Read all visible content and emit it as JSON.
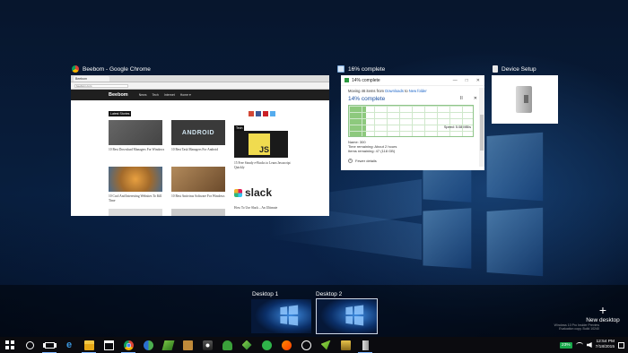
{
  "windows": [
    {
      "title": "Beebom - Google Chrome",
      "icon": "chrome-icon"
    },
    {
      "title": "16% complete",
      "icon": "file-copy-icon"
    },
    {
      "title": "Device Setup",
      "icon": "device-setup-icon"
    }
  ],
  "chrome_page": {
    "tab_label": "Beebom",
    "url": "beebom.com",
    "logo": "Beebom",
    "nav": [
      "News",
      "Tech",
      "Internet",
      "Home ▾"
    ],
    "latest_tag": "Latest Stories",
    "tech_tag": "Tech",
    "android_tile": "ANDROID",
    "js_tile": "JS",
    "slack_tile": "slack",
    "articles": [
      "10 Best Download Managers For Windows",
      "10 Best Task Managers For Android",
      "10 Cool And Interesting Websites To Kill Time",
      "10 Best Antivirus Software For Windows",
      "15 Free Steady e-Books to Learn Javascript Quickly",
      "How To Use Slack – An Ultimate"
    ]
  },
  "transfer": {
    "title": "14% complete",
    "moving_prefix": "Moving 46 items from ",
    "source": "Downloads",
    "to_word": " to ",
    "destination": "New folder",
    "progress_label": "14% complete",
    "progress_percent": 14,
    "pause_glyph": "II",
    "cancel_glyph": "✕",
    "speed": "Speed: 5.08 MB/s",
    "name_line": "Name: 300",
    "time_line": "Time remaining: About 2 hours",
    "items_line": "Items remaining: 47 (118 GB)",
    "fewer_details": "Fewer details"
  },
  "desktops": [
    {
      "label": "Desktop 1",
      "active": false
    },
    {
      "label": "Desktop 2",
      "active": true
    }
  ],
  "new_desktop": {
    "plus": "+",
    "label": "New desktop"
  },
  "watermark": [
    "Windows 10 Pro Insider Preview",
    "Evaluation copy. Build 10240"
  ],
  "taskbar": {
    "apps": [
      "start-icon",
      "cortana-icon",
      "task-view-icon",
      "edge-icon",
      "file-explorer-icon",
      "store-icon",
      "chrome-icon",
      "app-icon",
      "app-icon",
      "app-icon",
      "app-icon",
      "app-icon",
      "app-icon",
      "app-icon",
      "app-icon",
      "app-icon",
      "app-icon",
      "app-icon"
    ],
    "battery": "23%",
    "time": "12:54 PM",
    "date": "7/18/2015"
  },
  "colors": {
    "accent": "#1a64c8",
    "progress_green": "#8dc97d",
    "battery_green": "#18a84b",
    "taskbar": "#0b0b0f"
  }
}
